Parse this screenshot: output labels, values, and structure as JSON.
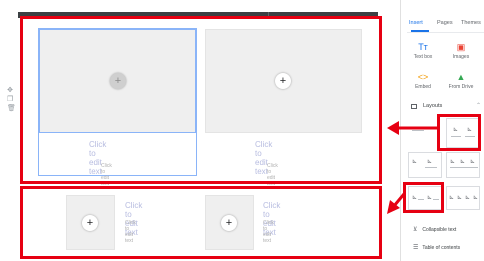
{
  "canvas": {
    "top_row": [
      {
        "big_text": "Click to edit text",
        "small_text": "Click to edit text",
        "button": "+"
      },
      {
        "big_text": "Click to edit text",
        "small_text": "Click to edit text",
        "button": "+"
      }
    ],
    "bottom_row": [
      {
        "big_text": "Click to edit text",
        "small_text": "Click to edit text",
        "button": "+"
      },
      {
        "big_text": "Click to edit text",
        "small_text": "Click to edit text",
        "button": "+"
      }
    ]
  },
  "panel": {
    "tabs": [
      {
        "label": "Insert",
        "active": true
      },
      {
        "label": "Pages",
        "active": false
      },
      {
        "label": "Themes",
        "active": false
      }
    ],
    "tools": [
      {
        "label": "Text box",
        "icon": "text-box-icon",
        "glyph": "Tт",
        "color": "#1a73e8"
      },
      {
        "label": "Images",
        "icon": "images-icon",
        "glyph": "▣",
        "color": "#ea4335"
      },
      {
        "label": "Embed",
        "icon": "embed-icon",
        "glyph": "<>",
        "color": "#fbbc04"
      },
      {
        "label": "From Drive",
        "icon": "drive-icon",
        "glyph": "▲",
        "color": "#34a853"
      }
    ],
    "layouts_label": "Layouts",
    "bottom_items": [
      {
        "label": "Collapsible text",
        "icon": "collapsible-text-icon",
        "glyph": "⊻"
      },
      {
        "label": "Table of contents",
        "icon": "table-of-contents-icon",
        "glyph": "☰"
      }
    ]
  },
  "colors": {
    "annotation": "#e60012",
    "accent": "#1a73e8"
  }
}
